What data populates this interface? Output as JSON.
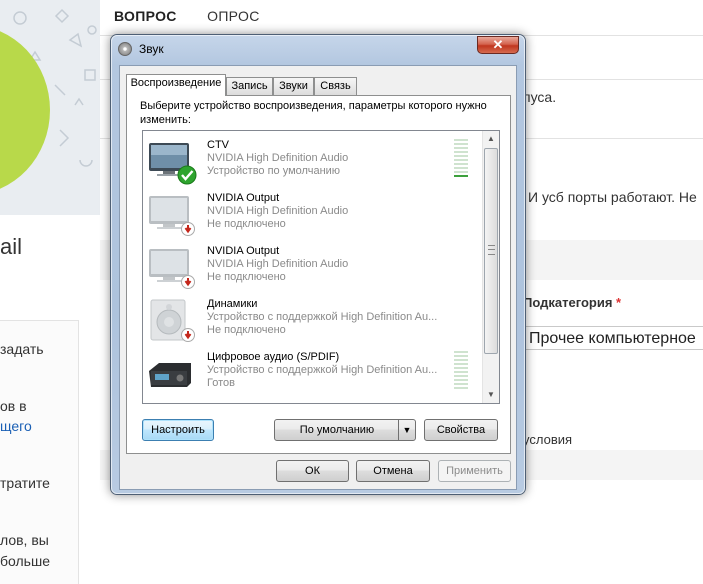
{
  "background": {
    "tabs": [
      "ВОПРОС",
      "ОПРОС"
    ],
    "left_texts": [
      "ail",
      "задать",
      "ов в",
      "щего",
      "тратите",
      "лов, вы",
      "больше"
    ],
    "right_texts": [
      "пуса.",
      "И усб порты работают. Не",
      "Подкатегория",
      "Прочее компьютерное",
      "условия"
    ],
    "required_mark": "*"
  },
  "dialog": {
    "title": "Звук",
    "close_symbol": "✕",
    "tabs": [
      "Воспроизведение",
      "Запись",
      "Звуки",
      "Связь"
    ],
    "active_tab": 0,
    "instruction": "Выберите устройство воспроизведения, параметры которого нужно изменить:",
    "devices": [
      {
        "name": "CTV",
        "line1": "NVIDIA High Definition Audio",
        "line2": "Устройство по умолчанию",
        "icon": "tv-monitor-icon",
        "status": "default-check-icon",
        "meter_level": 0.12
      },
      {
        "name": "NVIDIA Output",
        "line1": "NVIDIA High Definition Audio",
        "line2": "Не подключено",
        "icon": "tv-monitor-icon",
        "status": "disconnected-icon"
      },
      {
        "name": "NVIDIA Output",
        "line1": "NVIDIA High Definition Audio",
        "line2": "Не подключено",
        "icon": "tv-monitor-icon",
        "status": "disconnected-icon"
      },
      {
        "name": "Динамики",
        "line1": "Устройство с поддержкой High Definition Au...",
        "line2": "Не подключено",
        "icon": "speaker-icon",
        "status": "disconnected-icon"
      },
      {
        "name": "Цифровое аудио (S/PDIF)",
        "line1": "Устройство с поддержкой High Definition Au...",
        "line2": "Готов",
        "icon": "receiver-icon",
        "meter_level": 0.0
      }
    ],
    "buttons": {
      "configure": "Настроить",
      "default": "По умолчанию",
      "default_arrow": "▼",
      "properties": "Свойства",
      "ok": "ОК",
      "cancel": "Отмена",
      "apply": "Применить"
    },
    "scroll_up": "▲",
    "scroll_down": "▼"
  },
  "colors": {
    "accent_green": "#b8d94a",
    "check_green": "#2ea42e",
    "disconnect_red": "#c4271c",
    "link_blue": "#1a5fb4"
  }
}
